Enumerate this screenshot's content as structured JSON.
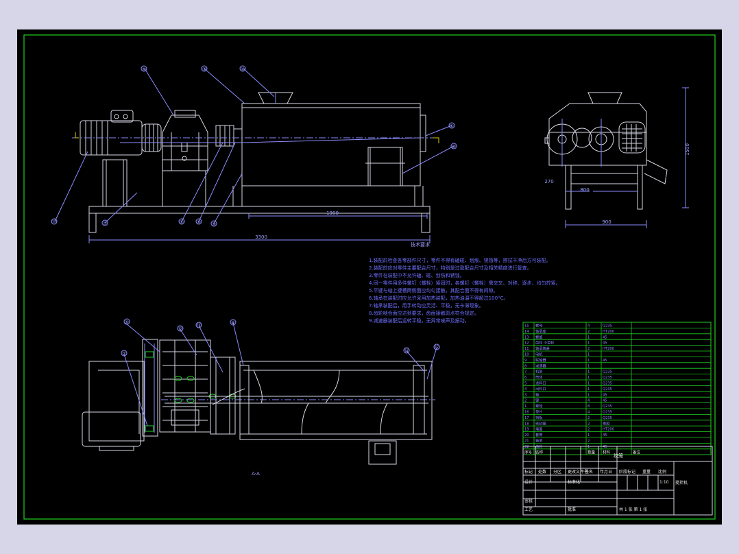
{
  "sheet": {
    "colors": {
      "background": "#000000",
      "frame": "#1fd11f",
      "blue_lines": "#8c8cff",
      "white_lines": "#d8d8e6",
      "notes": "#6f6fff",
      "ui_background": "#d6d6e8"
    }
  },
  "front_view": {
    "balloons": [
      "⑤",
      "③",
      "④",
      "①",
      "⑩",
      "⑪",
      "⑦",
      "⑥",
      "⑧",
      "⑨",
      "②"
    ],
    "dimensions": {
      "body_length": "1900",
      "overall_length": "3300"
    },
    "caption": "技术要求"
  },
  "side_view": {
    "dimensions": {
      "height": "1500",
      "offset": "270",
      "inner_width": "800",
      "outer_width": "900"
    }
  },
  "section_view": {
    "balloons": [
      "⑤",
      "⑫",
      "⑬",
      "⑧",
      "②",
      "⑭",
      "⑮"
    ],
    "label": "A-A"
  },
  "requirements": [
    "1.装配前检查各零部件尺寸，零件不得有磕碰、划痕、锈蚀等，擦拭干净后方可装配。",
    "2.装配前应对零件主要配合尺寸，特别是过盈配合尺寸及相关精度进行复查。",
    "3.零件在装配中不允许磕、碰、划伤和锈蚀。",
    "4.同一零件用多件螺钉（螺栓）紧固时，各螺钉（螺栓）需交叉、对称、逐步、均匀拧紧。",
    "5.平键与轴上键槽两侧面应均匀接触，其配合面不得有间隙。",
    "6.轴承在装配时应允许采用加热装配，加热油温不得超过100°C。",
    "7.轴承装配后，用手转动应灵活、平稳，无卡滞现象。",
    "8.齿轮啮合面应达到要求，齿面接触斑点符合规定。",
    "9.减速器装配后运转平稳，无异常噪声及振动。"
  ],
  "bom": {
    "rows": [
      [
        "15",
        "螺母",
        "4",
        "Q235"
      ],
      [
        "14",
        "轴承座",
        "2",
        "HT200"
      ],
      [
        "13",
        "螺旋",
        "1",
        "45"
      ],
      [
        "12",
        "齿轮 小齿轮",
        "1",
        "45"
      ],
      [
        "11",
        "轴承端盖",
        "2",
        "HT200"
      ],
      [
        "10",
        "电机",
        "1",
        ""
      ],
      [
        "9",
        "联轴器",
        "1",
        "45"
      ],
      [
        "8",
        "减速器",
        "1",
        ""
      ],
      [
        "7",
        "机架",
        "1",
        "Q235"
      ],
      [
        "6",
        "筒体",
        "1",
        "Q235"
      ],
      [
        "5",
        "进料口",
        "1",
        "Q235"
      ],
      [
        "4",
        "出料口",
        "1",
        "Q235"
      ],
      [
        "3",
        "轴",
        "1",
        "45"
      ],
      [
        "2",
        "键",
        "4",
        "45"
      ],
      [
        "1",
        "螺栓",
        "8",
        "Q235"
      ],
      [
        "16",
        "垫片",
        "4",
        "Q235"
      ],
      [
        "17",
        "挡板",
        "2",
        "Q235"
      ],
      [
        "18",
        "密封圈",
        "2",
        "橡胶"
      ],
      [
        "19",
        "端盖",
        "2",
        "HT200"
      ],
      [
        "20",
        "套筒",
        "1",
        "45"
      ],
      [
        "21",
        "轴承",
        "2",
        ""
      ],
      [
        "22",
        "齿轮",
        "1",
        "45"
      ]
    ],
    "header": [
      "序号",
      "名称",
      "数量",
      "材料",
      "备注"
    ]
  },
  "title_block": {
    "title": "绞笼",
    "drawing_name": "搅拌机",
    "row_labels": {
      "mark": "标记",
      "count": "处数",
      "zone": "分区",
      "doc_no": "更改文件号",
      "sign": "签名",
      "date": "年月日",
      "design": "设计",
      "standard": "标准化",
      "stage": "阶段标记",
      "weight": "重量",
      "scale": "比例",
      "review": "审核",
      "process": "工艺",
      "approve": "批准"
    },
    "scale_value": "1:10",
    "sheet_info": "共 1 张 第 1 张"
  }
}
